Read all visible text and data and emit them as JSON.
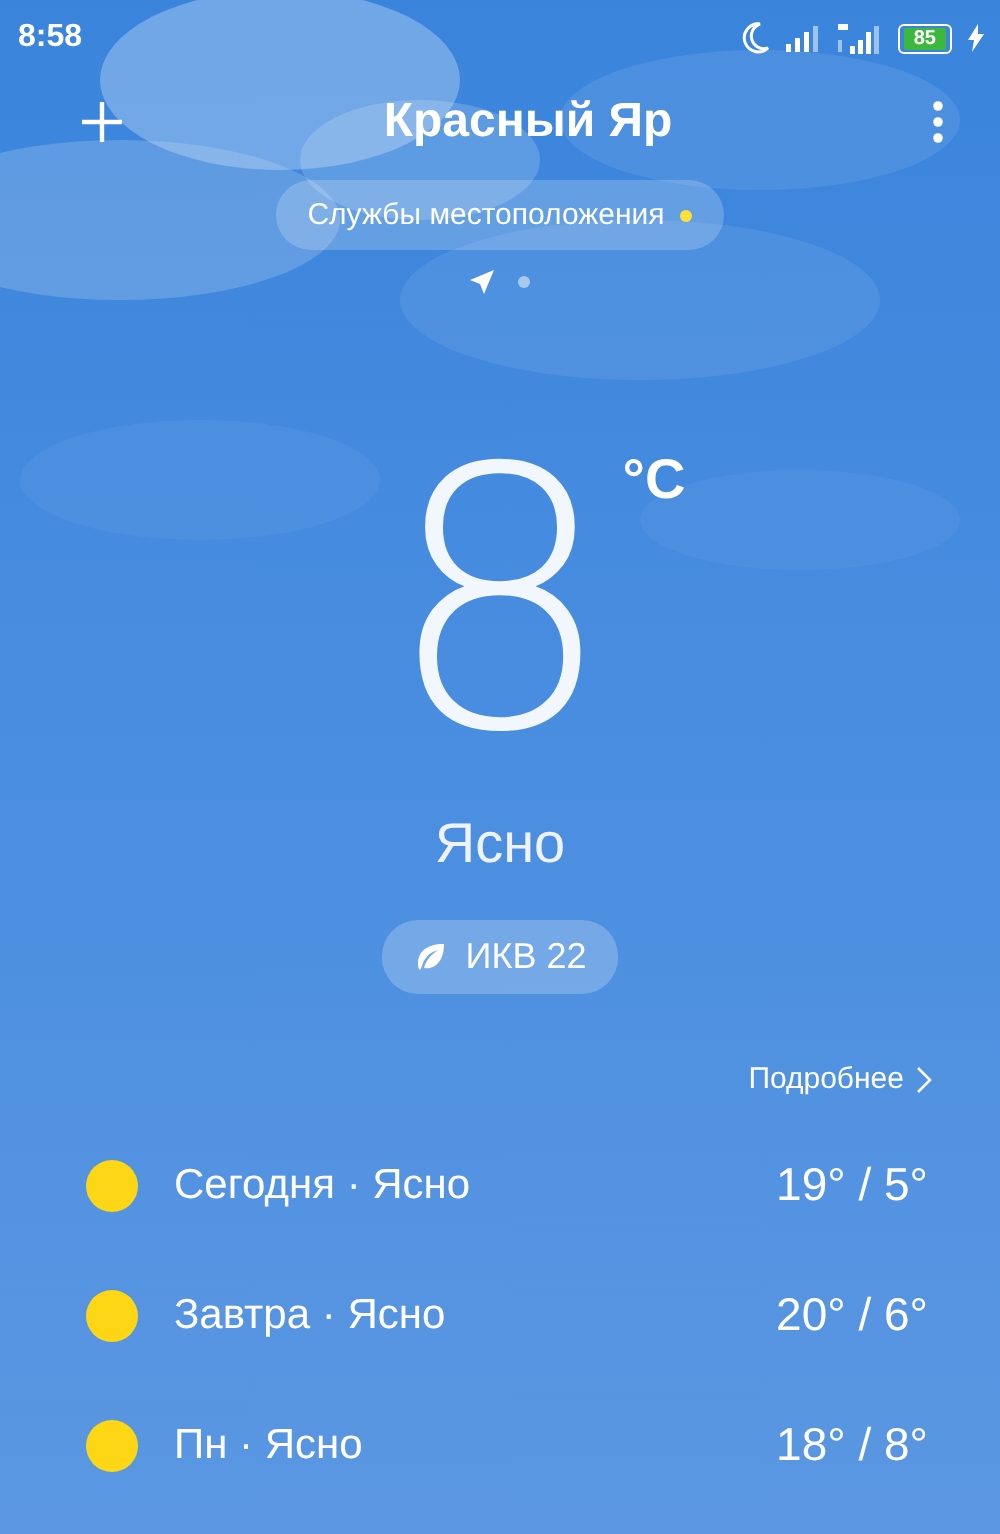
{
  "status_bar": {
    "time": "8:58",
    "battery": "85"
  },
  "header": {
    "city": "Красный Яр"
  },
  "location_pill": {
    "label": "Службы местоположения"
  },
  "pages": [
    {
      "kind": "location",
      "selected": true
    },
    {
      "kind": "dot",
      "selected": false
    }
  ],
  "current": {
    "temperature": "8",
    "unit": "°C",
    "condition": "Ясно",
    "aqi": "ИКВ 22"
  },
  "more_link": "Подробнее",
  "forecast": [
    {
      "label": "Сегодня · Ясно",
      "temps": "19° / 5°"
    },
    {
      "label": "Завтра · Ясно",
      "temps": "20° / 6°"
    },
    {
      "label": "Пн · Ясно",
      "temps": "18° / 8°"
    }
  ]
}
